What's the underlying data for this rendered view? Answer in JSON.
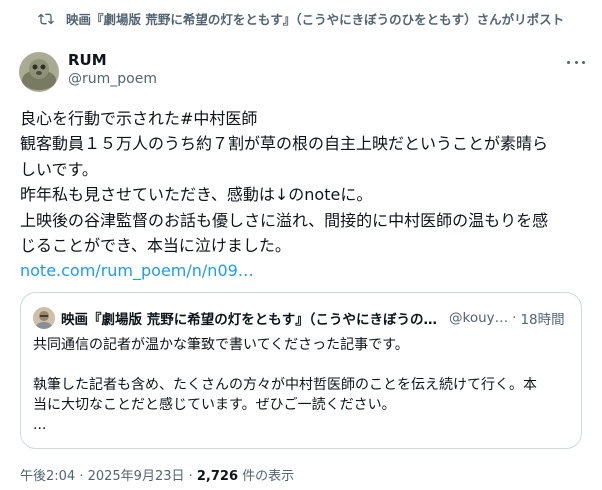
{
  "repost": {
    "icon": "repost-icon",
    "text": "映画『劇場版 荒野に希望の灯をともす』（こうやにきぼうのひをともす）さんがリポスト"
  },
  "author": {
    "name": "RUM",
    "handle": "@rum_poem"
  },
  "post": {
    "lines": [
      "良心を行動で示された#中村医師",
      "観客動員１５万人のうち約７割が草の根の自主上映だということが素晴ら",
      "しいです。",
      "昨年私も見させていただき、感動は↓のnoteに。",
      "上映後の谷津監督のお話も優しさに溢れ、間接的に中村医師の温もりを感",
      "じることができ、本当に泣けました。"
    ],
    "link": "note.com/rum_poem/n/n09…"
  },
  "quote": {
    "name": "映画『劇場版 荒野に希望の灯をともす』（こうやにきぼうのひをともす）",
    "handle": "@kouy…",
    "separator": "·",
    "time": "18時間",
    "lines": [
      "共同通信の記者が温かな筆致で書いてくださった記事です。",
      "",
      "執筆した記者も含め、たくさんの方々が中村哲医師のことを伝え続けて行く。本",
      "当に大切なことだと感じています。ぜひご一読ください。",
      "..."
    ]
  },
  "meta": {
    "time": "午後2:04 · 2025年9月23日 · ",
    "views": "2,726",
    "views_label": " 件の表示"
  },
  "colors": {
    "text": "#0f1419",
    "secondary": "#536471",
    "link": "#1d9bf0",
    "border": "#cfd9de"
  }
}
